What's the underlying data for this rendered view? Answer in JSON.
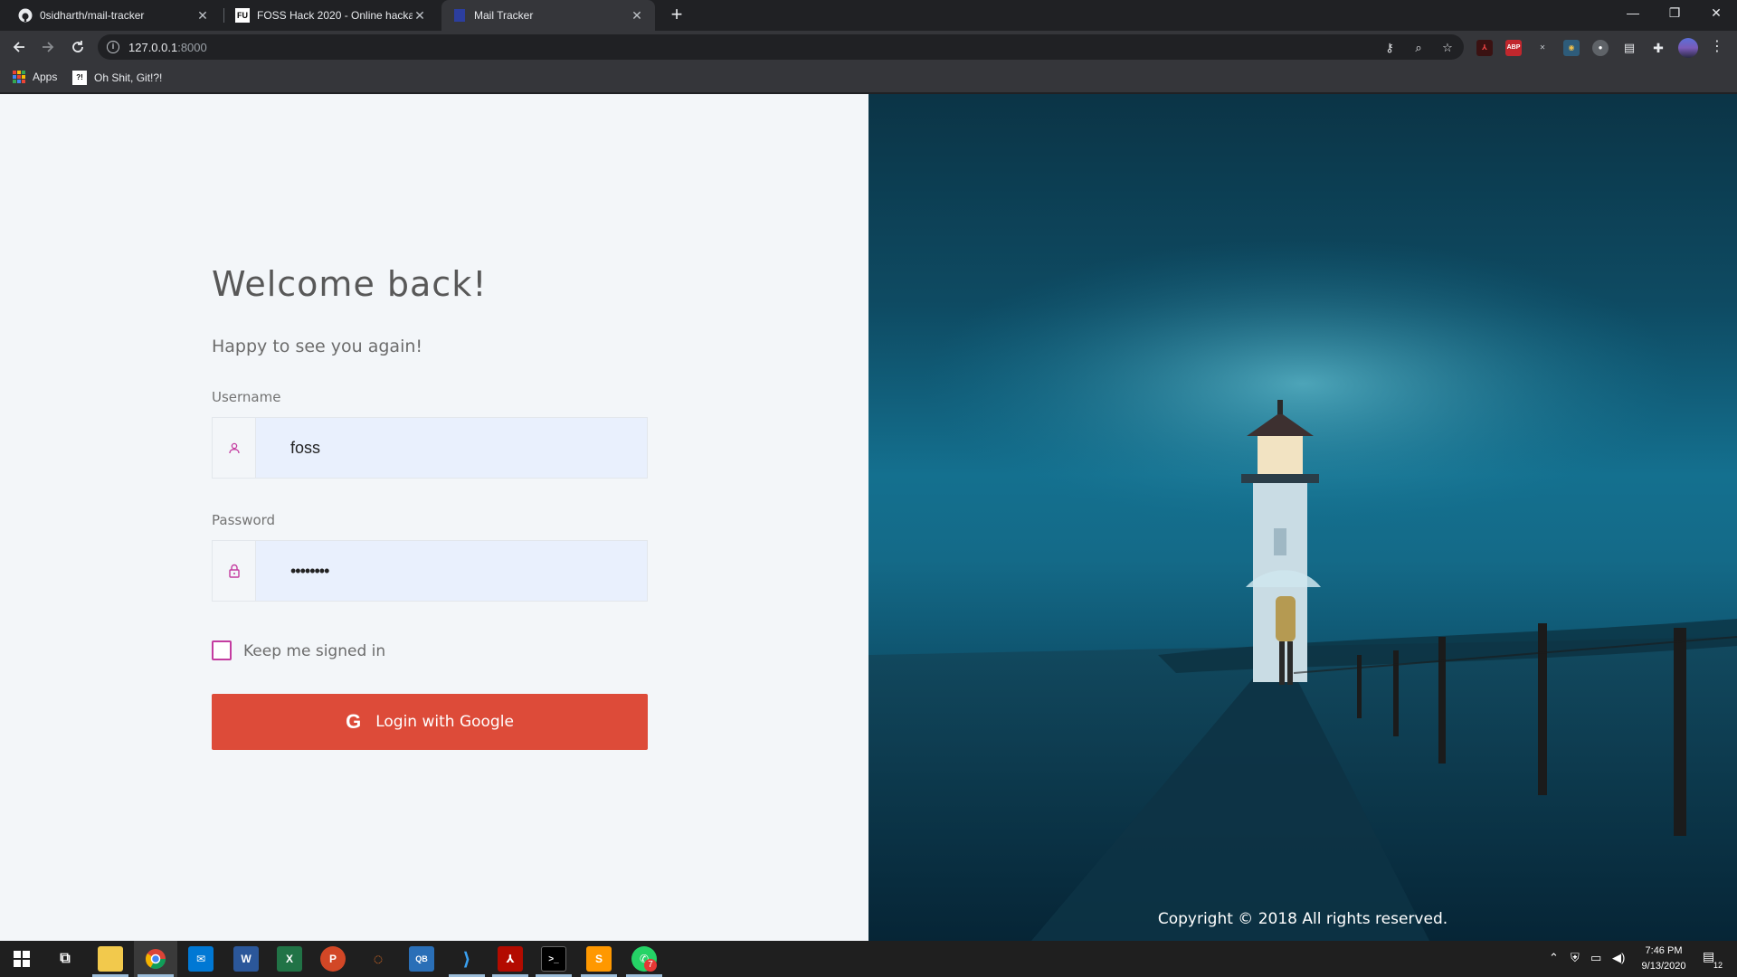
{
  "browser": {
    "tabs": [
      {
        "title": "0sidharth/mail-tracker",
        "favicon": "github-icon",
        "active": false
      },
      {
        "title": "FOSS Hack 2020 - Online hackath",
        "favicon": "fosshack-icon",
        "favicon_text": "FU",
        "active": false
      },
      {
        "title": "Mail Tracker",
        "favicon": "mail-tracker-icon",
        "active": true
      }
    ],
    "url_host": "127.0.0.1",
    "url_port": ":8000",
    "bookmarks": [
      {
        "label": "Apps",
        "icon": "apps-grid-icon"
      },
      {
        "label": "Oh Shit, Git!?!",
        "icon": "ohshitgit-icon",
        "icon_text": "?!"
      }
    ],
    "extensions": [
      {
        "name": "pdf-extension-icon",
        "text": "⅄"
      },
      {
        "name": "adblock-plus-icon",
        "text": "ABP"
      },
      {
        "name": "x-extension-icon",
        "text": "✕"
      },
      {
        "name": "owl-extension-icon",
        "text": "◉"
      },
      {
        "name": "circle-extension-icon",
        "text": "●"
      },
      {
        "name": "reader-extension-icon",
        "text": "▤"
      },
      {
        "name": "puzzle-extensions-icon",
        "text": "✚"
      }
    ]
  },
  "login": {
    "title": "Welcome back!",
    "subtitle": "Happy to see you again!",
    "username_label": "Username",
    "username_value": "foss",
    "password_label": "Password",
    "password_value": "••••••••",
    "keep_signed_in": "Keep me signed in",
    "keep_signed_in_checked": false,
    "google_button": "Login with Google",
    "google_glyph": "G",
    "accent_color": "#dd4b39",
    "icon_color": "#c43ca0"
  },
  "hero": {
    "copyright": "Copyright © 2018 All rights reserved."
  },
  "taskbar": {
    "apps": [
      "windows-start-icon",
      "task-view-icon",
      "file-explorer-icon",
      "chrome-icon",
      "mail-icon",
      "word-icon",
      "excel-icon",
      "powerpoint-icon",
      "jupyter-icon",
      "qbittorrent-icon",
      "vscode-icon",
      "acrobat-icon",
      "terminal-icon",
      "sublime-icon",
      "whatsapp-icon"
    ],
    "whatsapp_badge": "7",
    "time": "7:46 PM",
    "date": "9/13/2020",
    "notifications": "12"
  }
}
